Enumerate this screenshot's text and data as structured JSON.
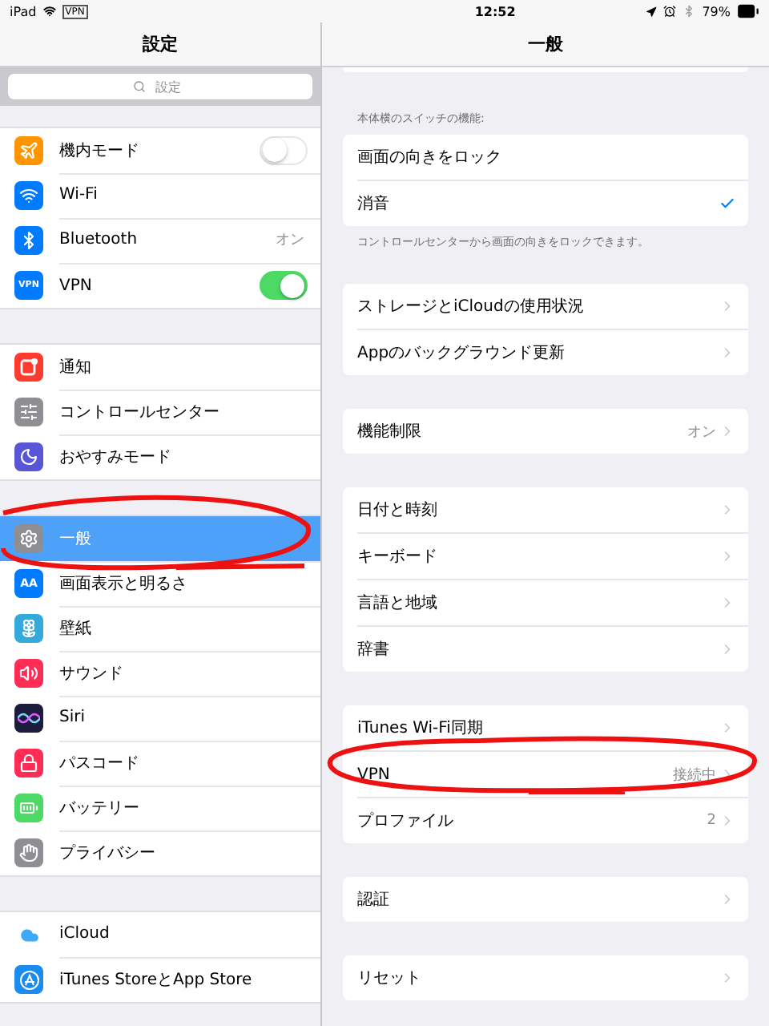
{
  "status_bar": {
    "device": "iPad",
    "vpn_badge": "VPN",
    "time": "12:52",
    "battery": "79%"
  },
  "sidebar": {
    "title": "設定",
    "search": {
      "placeholder": "設定"
    },
    "groups": [
      {
        "items": [
          {
            "label": "機内モード",
            "kind": "toggle",
            "on": false,
            "selected": false
          },
          {
            "label": "Wi-Fi",
            "kind": "plain",
            "selected": false
          },
          {
            "label": "Bluetooth",
            "kind": "value",
            "value": "オン",
            "selected": false
          },
          {
            "label": "VPN",
            "kind": "toggle",
            "on": true,
            "icon_text": "VPN",
            "selected": false
          }
        ]
      },
      {
        "items": [
          {
            "label": "通知",
            "kind": "plain",
            "selected": false
          },
          {
            "label": "コントロールセンター",
            "kind": "plain",
            "selected": false
          },
          {
            "label": "おやすみモード",
            "kind": "plain",
            "selected": false
          }
        ]
      },
      {
        "items": [
          {
            "label": "一般",
            "kind": "plain",
            "selected": true
          },
          {
            "label": "画面表示と明るさ",
            "kind": "plain",
            "icon_text": "AA",
            "selected": false
          },
          {
            "label": "壁紙",
            "kind": "plain",
            "selected": false
          },
          {
            "label": "サウンド",
            "kind": "plain",
            "selected": false
          },
          {
            "label": "Siri",
            "kind": "plain",
            "selected": false
          },
          {
            "label": "パスコード",
            "kind": "plain",
            "selected": false
          },
          {
            "label": "バッテリー",
            "kind": "plain",
            "selected": false
          },
          {
            "label": "プライバシー",
            "kind": "plain",
            "selected": false
          }
        ]
      },
      {
        "items": [
          {
            "label": "iCloud",
            "kind": "plain",
            "selected": false
          },
          {
            "label": "iTunes StoreとApp Store",
            "kind": "plain",
            "selected": false
          }
        ]
      }
    ]
  },
  "detail": {
    "title": "一般",
    "groups": [
      {
        "header": "本体横のスイッチの機能:",
        "footer": "コントロールセンターから画面の向きをロックできます。",
        "rows": [
          {
            "label": "画面の向きをロック",
            "kind": "check",
            "checked": false
          },
          {
            "label": "消音",
            "kind": "check",
            "checked": true
          }
        ]
      },
      {
        "rows": [
          {
            "label": "ストレージとiCloudの使用状況",
            "kind": "link"
          },
          {
            "label": "Appのバックグラウンド更新",
            "kind": "link"
          }
        ]
      },
      {
        "rows": [
          {
            "label": "機能制限",
            "kind": "link",
            "value": "オン"
          }
        ]
      },
      {
        "rows": [
          {
            "label": "日付と時刻",
            "kind": "link"
          },
          {
            "label": "キーボード",
            "kind": "link"
          },
          {
            "label": "言語と地域",
            "kind": "link"
          },
          {
            "label": "辞書",
            "kind": "link"
          }
        ]
      },
      {
        "rows": [
          {
            "label": "iTunes Wi-Fi同期",
            "kind": "link"
          },
          {
            "label": "VPN",
            "kind": "link",
            "value": "接続中"
          },
          {
            "label": "プロファイル",
            "kind": "link",
            "value": "2"
          }
        ]
      },
      {
        "rows": [
          {
            "label": "認証",
            "kind": "link"
          }
        ]
      },
      {
        "rows": [
          {
            "label": "リセット",
            "kind": "link"
          }
        ]
      }
    ]
  }
}
